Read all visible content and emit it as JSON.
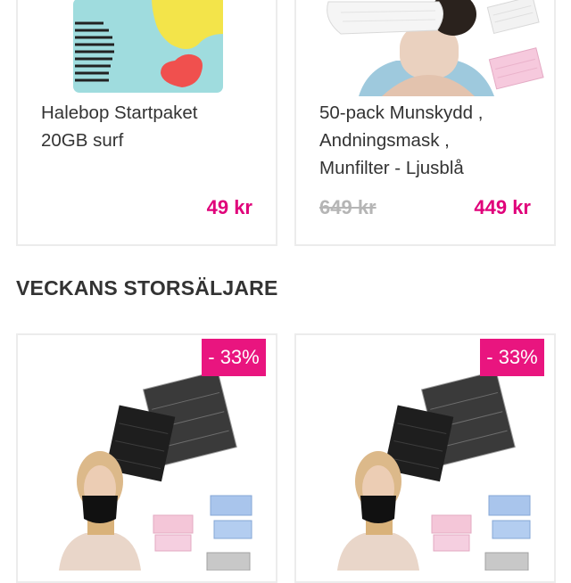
{
  "products_top": [
    {
      "title_line1": "Halebop Startpaket",
      "title_line2": "20GB surf",
      "price": "49 kr"
    },
    {
      "title_line1": "50-pack Munskydd ,",
      "title_line2": "Andningsmask ,",
      "title_line3": "Munfilter - Ljusblå",
      "old_price": "649 kr",
      "price": "449 kr"
    }
  ],
  "section": {
    "title": "VECKANS STORSÄLJARE"
  },
  "bestsellers": [
    {
      "badge": "- 33%"
    },
    {
      "badge": "- 33%"
    }
  ],
  "colors": {
    "accent": "#e0007a",
    "badge_bg": "#e9157f",
    "old_price": "#b5b5b5"
  }
}
